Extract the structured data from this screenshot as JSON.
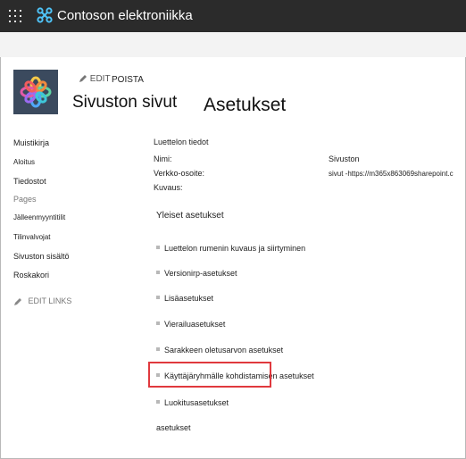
{
  "suitebar": {
    "app_launcher_icon": "waffle-icon",
    "brand_icon": "contoso-logo-icon",
    "site_name": "Contoson elektroniikka"
  },
  "header": {
    "edit_label": "EDIT",
    "delete_label": "POISTA",
    "site_title": "Sivuston sivut",
    "page_title": "Asetukset"
  },
  "nav": {
    "items": [
      {
        "label": "Muistikirja",
        "kind": "link"
      },
      {
        "label": "Aloitus",
        "kind": "link"
      },
      {
        "label": "Tiedostot",
        "kind": "link"
      },
      {
        "label": "Pages",
        "kind": "heading"
      },
      {
        "label": "Jälleenmyyntitilit",
        "kind": "link"
      },
      {
        "label": "Tilinvalvojat",
        "kind": "link"
      },
      {
        "label": "Sivuston sisältö",
        "kind": "link"
      },
      {
        "label": "Roskakori",
        "kind": "link"
      }
    ],
    "edit_links": "EDIT LINKS"
  },
  "list_info": {
    "heading": "Luettelon tiedot",
    "name_label": "Nimi:",
    "name_value": "Sivuston",
    "url_label": "Verkko-osoite:",
    "url_value": "sivut -https://m365x863069sharepoint.c",
    "desc_label": "Kuvaus:"
  },
  "general_settings": {
    "heading": "Yleiset asetukset",
    "links": [
      "Luettelon rumenin kuvaus ja siirtyminen",
      "Versionirp-asetukset",
      "Lisäasetukset",
      "Vierailuasetukset",
      "Sarakkeen oletusarvon asetukset",
      "Käyttäjäryhmälle kohdistamisen asetukset",
      "Luokitusasetukset"
    ],
    "trailing": "asetukset"
  },
  "colors": {
    "suitebar": "#2b2b2b",
    "highlight": "#e0393e",
    "brand_icon": "#4fc3f7"
  }
}
